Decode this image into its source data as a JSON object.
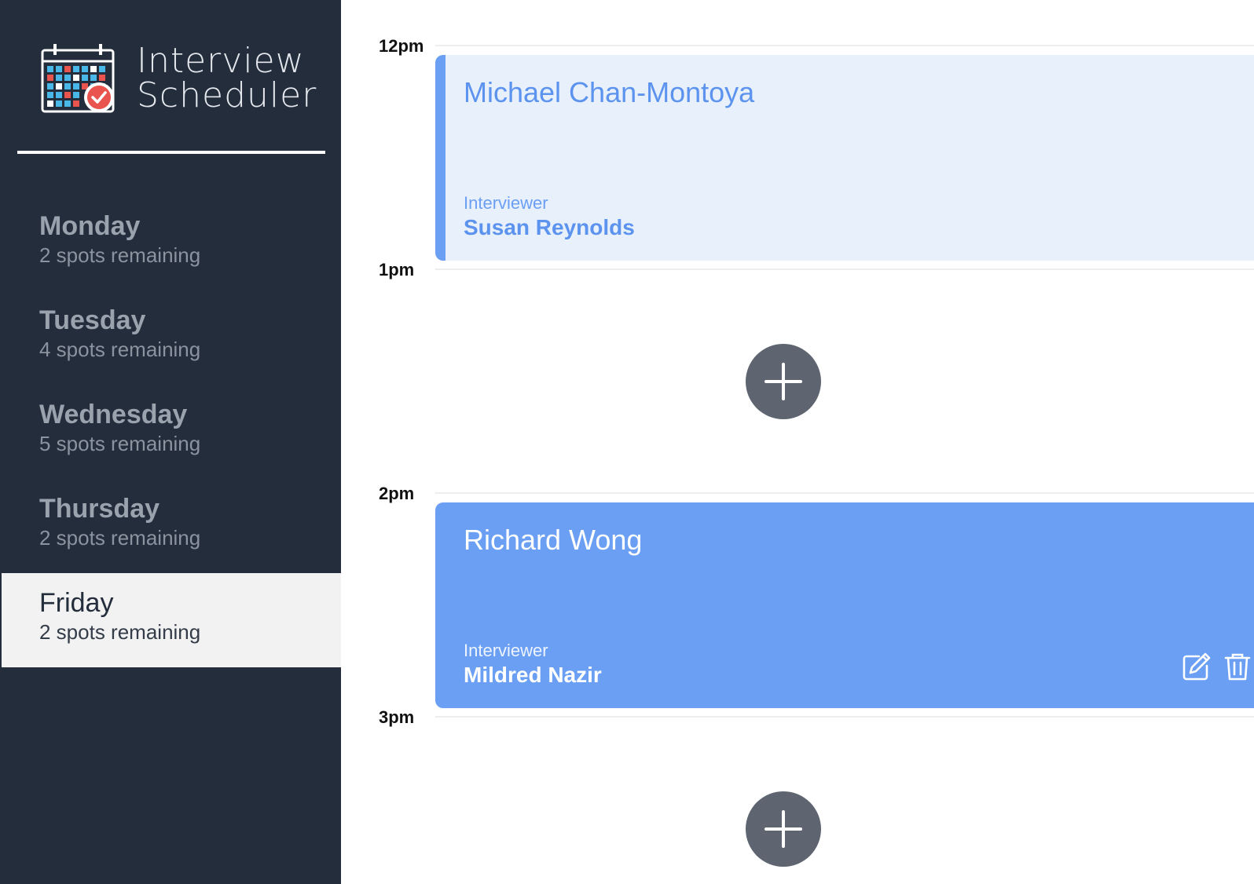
{
  "app": {
    "title_line1": "Interview",
    "title_line2": "Scheduler"
  },
  "sidebar": {
    "days": [
      {
        "name": "Monday",
        "spots": "2 spots remaining",
        "selected": false
      },
      {
        "name": "Tuesday",
        "spots": "4 spots remaining",
        "selected": false
      },
      {
        "name": "Wednesday",
        "spots": "5 spots remaining",
        "selected": false
      },
      {
        "name": "Thursday",
        "spots": "2 spots remaining",
        "selected": false
      },
      {
        "name": "Friday",
        "spots": "2 spots remaining",
        "selected": true
      }
    ]
  },
  "schedule": {
    "hours": [
      "12pm",
      "1pm",
      "2pm",
      "3pm"
    ],
    "appointments": [
      {
        "time": "12pm",
        "student": "Michael Chan-Montoya",
        "interviewer_label": "Interviewer",
        "interviewer": "Susan Reynolds",
        "state": "light"
      },
      {
        "time": "2pm",
        "student": "Richard Wong",
        "interviewer_label": "Interviewer",
        "interviewer": "Mildred Nazir",
        "state": "hovered"
      }
    ]
  },
  "colors": {
    "sidebar_bg": "#232d3c",
    "accent": "#6a9ff3",
    "appointment_light_bg": "#e8f0fc",
    "add_button": "#5e6570",
    "selected_day_bg": "#f2f2f2"
  },
  "icons": {
    "logo": "calendar-check-icon",
    "add": "plus-icon",
    "edit": "edit-icon",
    "delete": "trash-icon"
  }
}
